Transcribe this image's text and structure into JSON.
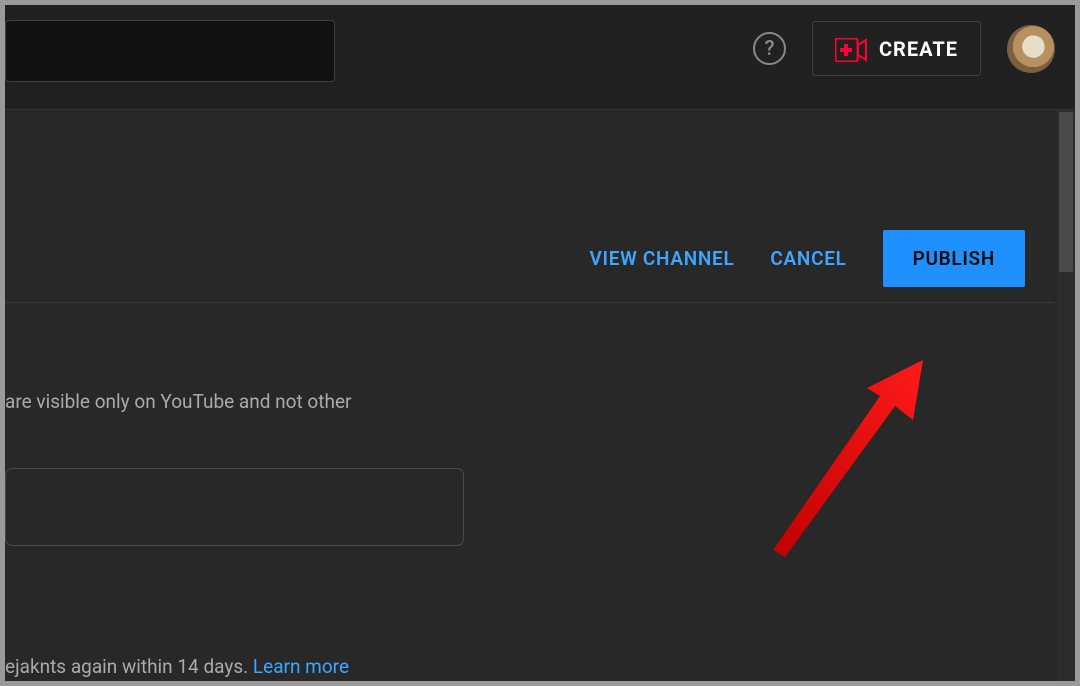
{
  "header": {
    "help_tooltip": "?",
    "create_label": "CREATE"
  },
  "actions": {
    "view_channel": "VIEW CHANNEL",
    "cancel": "CANCEL",
    "publish": "PUBLISH"
  },
  "body": {
    "visibility_note": "are visible only on YouTube and not other",
    "handle_note_prefix": "ejaknts again within 14 days. ",
    "learn_more": "Learn more"
  }
}
